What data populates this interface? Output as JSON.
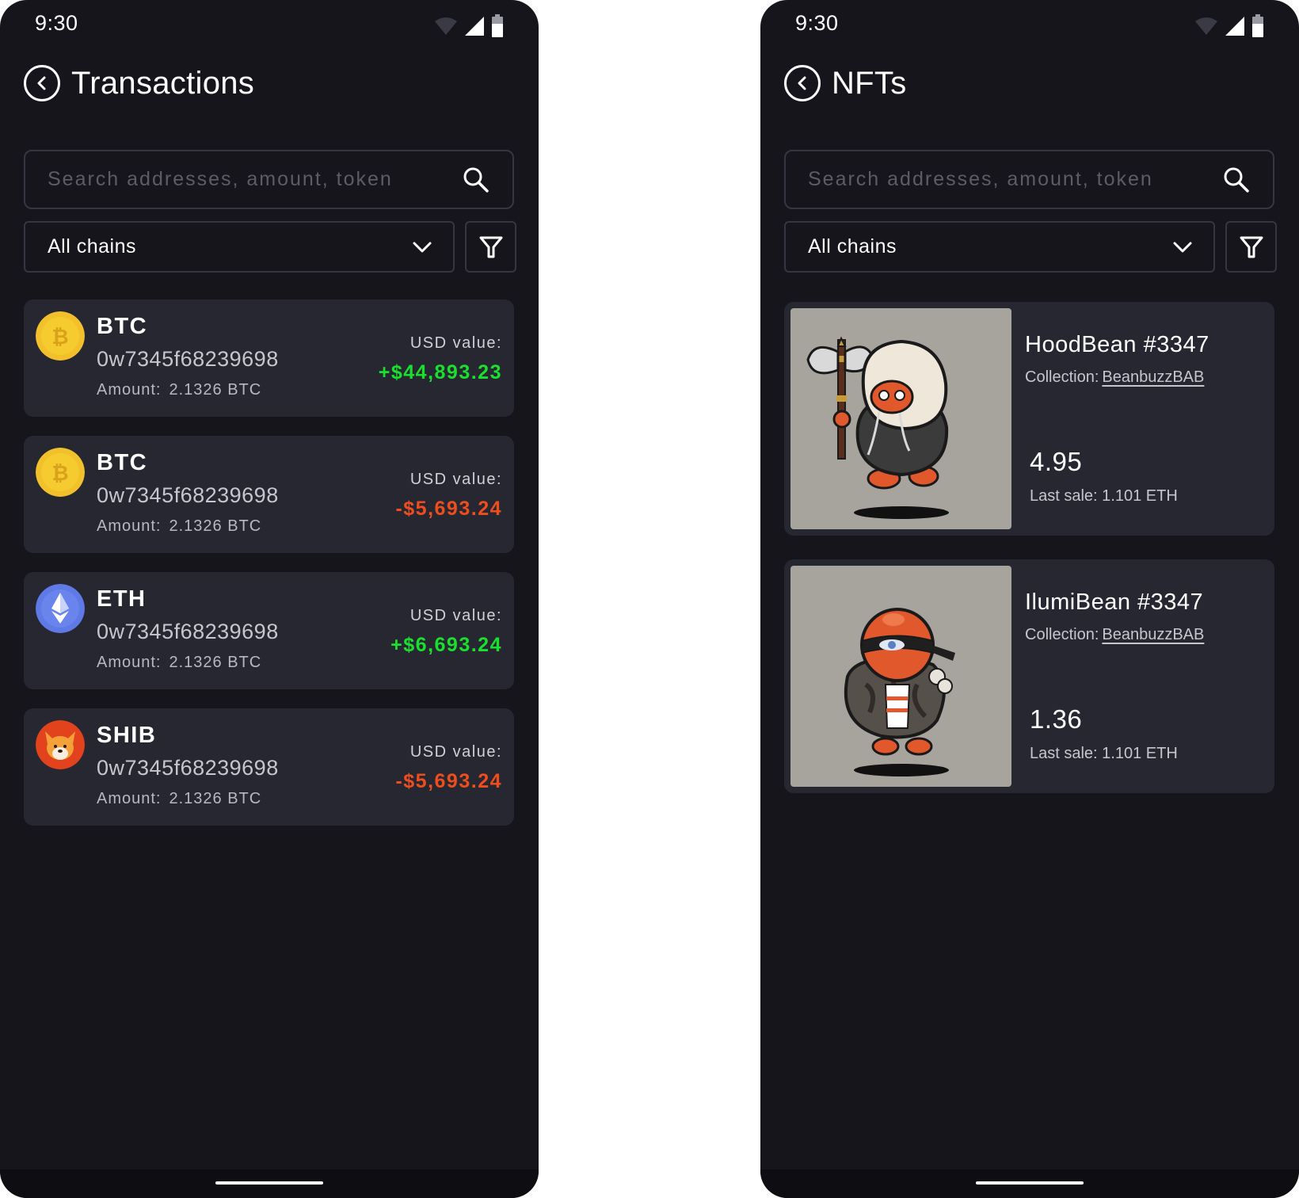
{
  "colors": {
    "phone_bg": "#15151b",
    "card_bg": "#272731",
    "positive": "#19e02d",
    "negative": "#ee4e1e",
    "muted_text": "#c6c6cf",
    "border": "#363642"
  },
  "transactions_screen": {
    "status_time": "9:30",
    "title": "Transactions",
    "search_placeholder": "Search addresses, amount, token",
    "chains_label": "All chains",
    "transactions": [
      {
        "icon": "bitcoin-coin-icon",
        "token": "BTC",
        "address": "0w7345f68239698",
        "amount_label": "Amount:",
        "amount_value": "2.1326 BTC",
        "usd_label": "USD value:",
        "usd_value": "+$44,893.23",
        "direction": "positive"
      },
      {
        "icon": "bitcoin-coin-icon",
        "token": "BTC",
        "address": "0w7345f68239698",
        "amount_label": "Amount:",
        "amount_value": "2.1326 BTC",
        "usd_label": "USD value:",
        "usd_value": "-$5,693.24",
        "direction": "negative"
      },
      {
        "icon": "ethereum-coin-icon",
        "token": "ETH",
        "address": "0w7345f68239698",
        "amount_label": "Amount:",
        "amount_value": "2.1326 BTC",
        "usd_label": "USD value:",
        "usd_value": "+$6,693.24",
        "direction": "positive"
      },
      {
        "icon": "shiba-coin-icon",
        "token": "SHIB",
        "address": "0w7345f68239698",
        "amount_label": "Amount:",
        "amount_value": "2.1326 BTC",
        "usd_label": "USD value:",
        "usd_value": "-$5,693.24",
        "direction": "negative"
      }
    ]
  },
  "nfts_screen": {
    "status_time": "9:30",
    "title": "NFTs",
    "search_placeholder": "Search addresses, amount, token",
    "chains_label": "All chains",
    "nfts": [
      {
        "image": "hoodbean-character-image",
        "name": "HoodBean #3347",
        "collection_label": "Collection:",
        "collection_name": "BeanbuzzBAB",
        "price": "4.95",
        "last_sale": "Last sale: 1.101 ETH"
      },
      {
        "image": "illumibean-character-image",
        "name": "IlumiBean #3347",
        "collection_label": "Collection:",
        "collection_name": "BeanbuzzBAB",
        "price": "1.36",
        "last_sale": "Last sale: 1.101 ETH"
      }
    ]
  }
}
